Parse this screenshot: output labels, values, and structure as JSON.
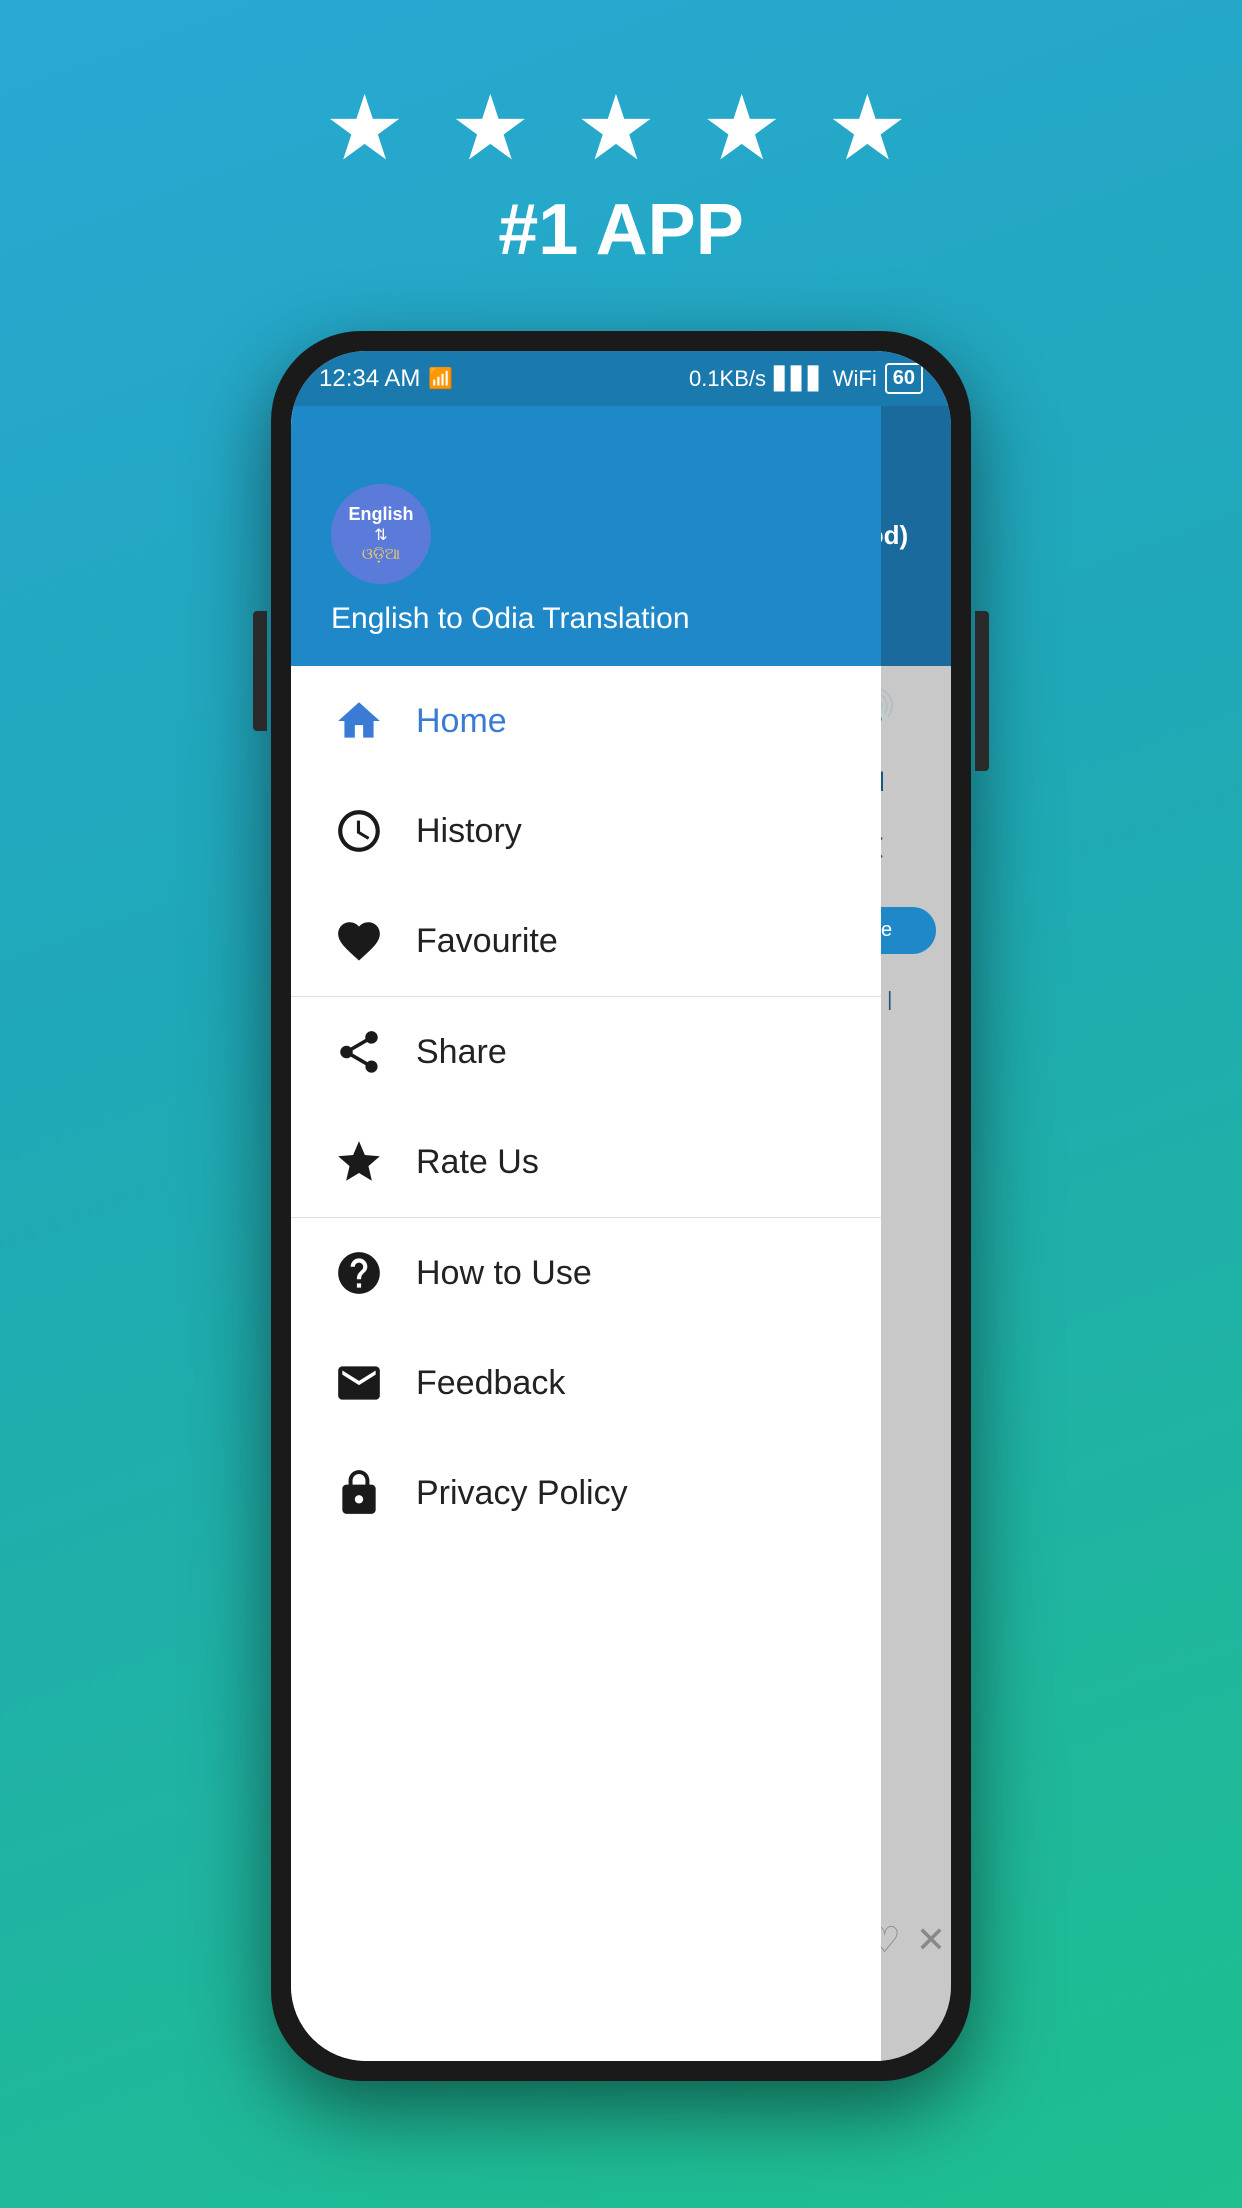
{
  "top": {
    "stars": "★ ★ ★ ★ ★",
    "app_label": "#1 APP"
  },
  "status_bar": {
    "time": "12:34 AM",
    "network_indicator": "N",
    "speed": "0.1KB/s",
    "battery": "60"
  },
  "app_header": {
    "logo_english": "English",
    "logo_arrow": "⇅",
    "logo_odia": "ଓଡ଼ିଆ",
    "title": "English to Odia Translation"
  },
  "menu_items": [
    {
      "id": "home",
      "label": "Home",
      "icon": "home",
      "colored": true,
      "section": 1
    },
    {
      "id": "history",
      "label": "History",
      "icon": "clock",
      "colored": false,
      "section": 1
    },
    {
      "id": "favourite",
      "label": "Favourite",
      "icon": "heart",
      "colored": false,
      "section": 1
    },
    {
      "id": "share",
      "label": "Share",
      "icon": "share",
      "colored": false,
      "section": 2
    },
    {
      "id": "rate-us",
      "label": "Rate Us",
      "icon": "star",
      "colored": false,
      "section": 2
    },
    {
      "id": "how-to-use",
      "label": "How to Use",
      "icon": "question",
      "colored": false,
      "section": 3
    },
    {
      "id": "feedback",
      "label": "Feedback",
      "icon": "mail",
      "colored": false,
      "section": 3
    },
    {
      "id": "privacy-policy",
      "label": "Privacy Policy",
      "icon": "lock",
      "colored": false,
      "section": 3
    }
  ],
  "right_partial": {
    "top_text": "ଆ(od)",
    "translate_btn": "slate",
    "odia_text": "ବାଦ |"
  }
}
